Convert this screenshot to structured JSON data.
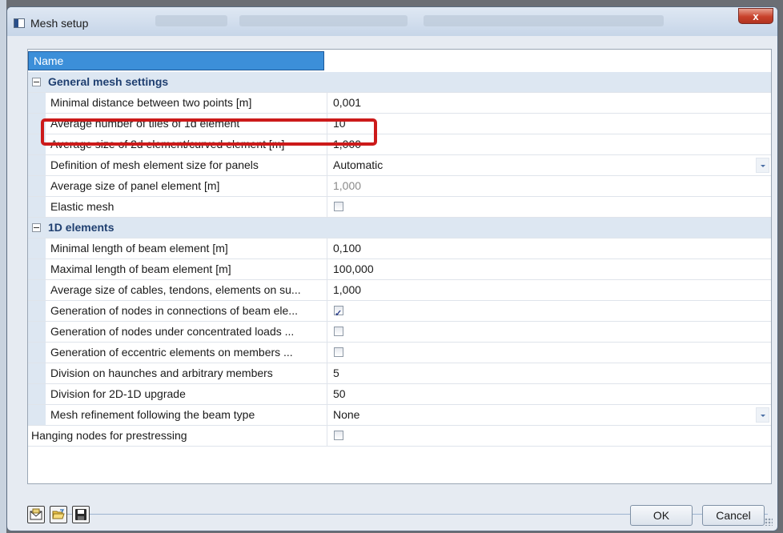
{
  "window": {
    "title": "Mesh setup",
    "close_label": "x"
  },
  "grid": {
    "name_header": "Name",
    "categories": {
      "general": "General mesh settings",
      "one_d": "1D elements"
    },
    "rows": {
      "min_distance": {
        "label": "Minimal distance between two points [m]",
        "value": "0,001"
      },
      "avg_tiles": {
        "label": "Average number of tiles of 1d element",
        "value": "10"
      },
      "avg_2d_size": {
        "label": "Average size of 2d element/curved element [m]",
        "value": "1,000"
      },
      "panel_def": {
        "label": "Definition of mesh element size for panels",
        "value": "Automatic"
      },
      "panel_size": {
        "label": "Average size of panel element [m]",
        "value": "1,000"
      },
      "elastic_mesh": {
        "label": "Elastic mesh",
        "checked": false
      },
      "min_beam": {
        "label": "Minimal length of beam element [m]",
        "value": "0,100"
      },
      "max_beam": {
        "label": "Maximal length of beam element [m]",
        "value": "100,000"
      },
      "cables": {
        "label": "Average size of cables, tendons, elements on su...",
        "value": "1,000"
      },
      "gen_conn": {
        "label": "Generation of nodes in connections of beam ele...",
        "checked": true
      },
      "gen_loads": {
        "label": "Generation of nodes under concentrated loads ...",
        "checked": false
      },
      "gen_ecc": {
        "label": "Generation of eccentric elements on members ...",
        "checked": false
      },
      "haunches": {
        "label": "Division on haunches and arbitrary members",
        "value": "5"
      },
      "div_2d1d": {
        "label": "Division for 2D-1D upgrade",
        "value": "50"
      },
      "refinement": {
        "label": "Mesh refinement following the beam type",
        "value": "None"
      },
      "hanging": {
        "label": "Hanging nodes for prestressing",
        "checked": false
      }
    }
  },
  "footer": {
    "ok_label": "OK",
    "cancel_label": "Cancel"
  },
  "icons": [
    "window-icon",
    "close-icon",
    "collapse-icon",
    "dropdown-arrow-icon",
    "checkbox-icon",
    "envelope-icon",
    "open-folder-icon",
    "save-icon",
    "resize-grip-icon"
  ],
  "colors": {
    "selection": "#3c8fd9",
    "category_bg": "#dde7f2",
    "highlight": "#cc1a1a",
    "category_text": "#1f3f70"
  }
}
